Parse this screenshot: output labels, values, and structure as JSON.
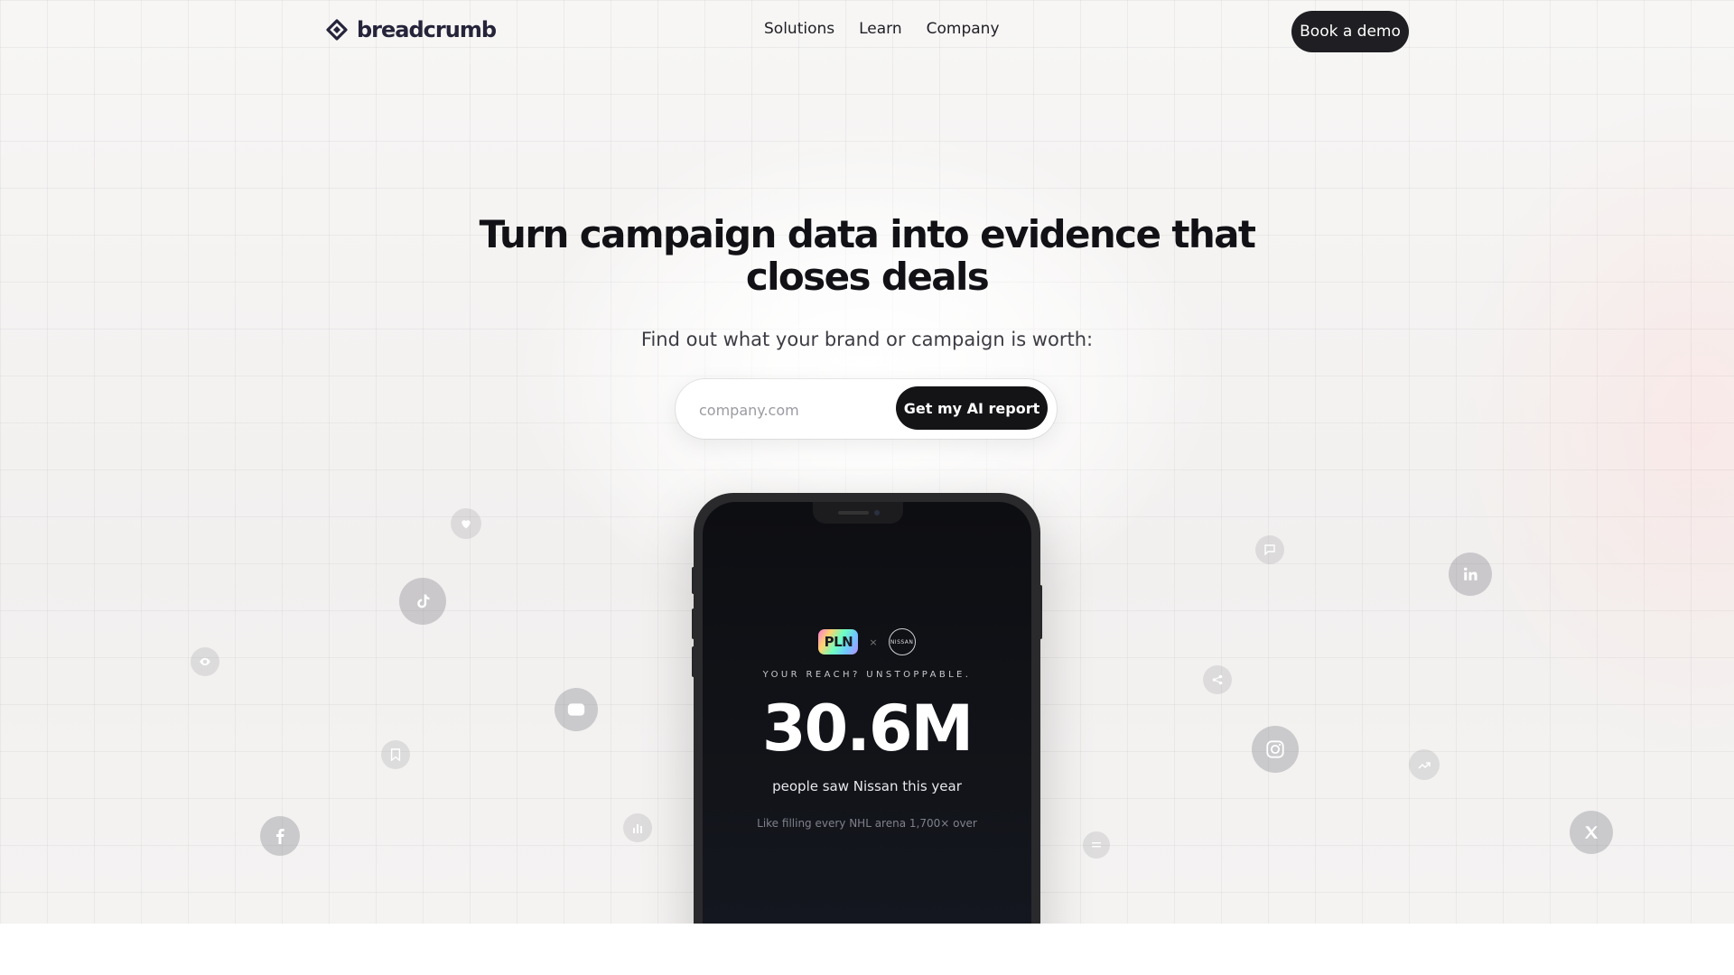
{
  "nav": {
    "logo_text": "breadcrumb",
    "links": [
      {
        "label": "Solutions"
      },
      {
        "label": "Learn"
      },
      {
        "label": "Company"
      }
    ],
    "cta": "Book a demo"
  },
  "hero": {
    "headline": "Turn campaign data into evidence that closes deals",
    "subhead": "Find out what your brand or campaign is worth:",
    "input_placeholder": "company.com",
    "input_value": "",
    "submit_label": "Get my AI report"
  },
  "phone": {
    "brand_left": "PLN",
    "separator": "×",
    "brand_right": "NISSAN",
    "tagline": "YOUR REACH? UNSTOPPABLE.",
    "metric": "30.6M",
    "metric_desc": "people saw Nissan this year",
    "metric_sub": "Like filling every NHL arena 1,700× over"
  },
  "floating_icons": [
    "heart-icon",
    "tiktok-icon",
    "eye-icon",
    "youtube-icon",
    "bookmark-icon",
    "facebook-icon",
    "bar-chart-icon",
    "comment-icon",
    "linkedin-icon",
    "share-icon",
    "instagram-icon",
    "trending-icon",
    "x-twitter-icon",
    "list-icon"
  ]
}
